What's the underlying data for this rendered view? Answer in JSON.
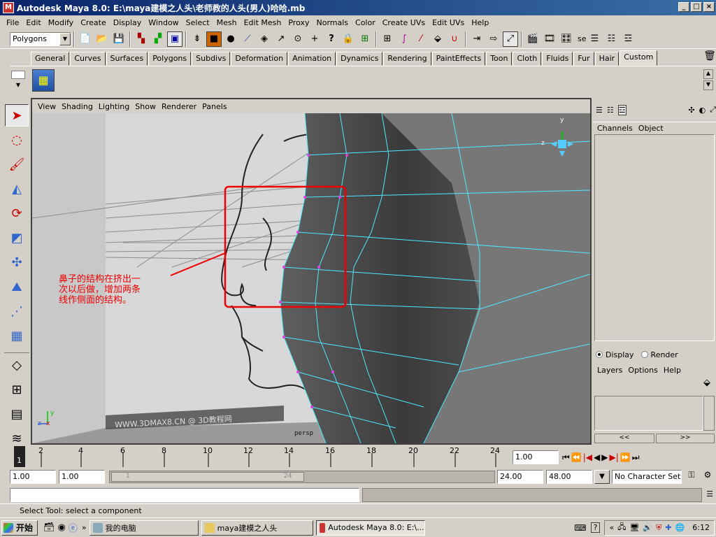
{
  "window": {
    "title": "Autodesk Maya 8.0: E:\\maya建模之人头\\老师教的人头(男人)哈哈.mb",
    "min": "_",
    "max": "□",
    "close": "×"
  },
  "menu": [
    "File",
    "Edit",
    "Modify",
    "Create",
    "Display",
    "Window",
    "Select",
    "Mesh",
    "Edit Mesh",
    "Proxy",
    "Normals",
    "Color",
    "Create UVs",
    "Edit UVs",
    "Help"
  ],
  "statusline": {
    "mode": "Polygons",
    "extra": "se"
  },
  "shelf_tabs": [
    "General",
    "Curves",
    "Surfaces",
    "Polygons",
    "Subdivs",
    "Deformation",
    "Animation",
    "Dynamics",
    "Rendering",
    "PaintEffects",
    "Toon",
    "Cloth",
    "Fluids",
    "Fur",
    "Hair",
    "Custom"
  ],
  "shelf_active": "Custom",
  "viewport": {
    "menu": [
      "View",
      "Shading",
      "Lighting",
      "Show",
      "Renderer",
      "Panels"
    ],
    "camera_label": "persp",
    "annotation": [
      "鼻子的结构在挤出一",
      "次以后做，增加两条",
      "线作侧面的结构。"
    ],
    "watermark": "WWW.3DMAX8.CN @ 3D教程网",
    "axes": {
      "x": "x",
      "y": "y",
      "z": "z"
    }
  },
  "channelbox": {
    "menu": [
      "Channels",
      "Object"
    ],
    "layer_radio": [
      "Display",
      "Render"
    ],
    "layer_menu": [
      "Layers",
      "Options",
      "Help"
    ],
    "scroll_left": "<<",
    "scroll_right": ">>"
  },
  "timeline": {
    "ticks": [
      "2",
      "4",
      "6",
      "8",
      "10",
      "12",
      "14",
      "16",
      "18",
      "20",
      "22",
      "24"
    ],
    "current_frame": "1",
    "current_time": "1.00"
  },
  "range": {
    "start_time": "1.00",
    "start_range": "1.00",
    "slider_start": "1",
    "slider_end": "24",
    "end_range": "24.00",
    "end_time": "48.00",
    "character_set": "No Character Set"
  },
  "helpline": "Select Tool: select a component",
  "taskbar": {
    "start": "开始",
    "tasks": [
      "我的电脑",
      "maya建模之人头",
      "Autodesk Maya 8.0: E:\\..."
    ],
    "clock": "6:12",
    "chevron": "»",
    "tray_chevron": "«",
    "help": "?"
  }
}
